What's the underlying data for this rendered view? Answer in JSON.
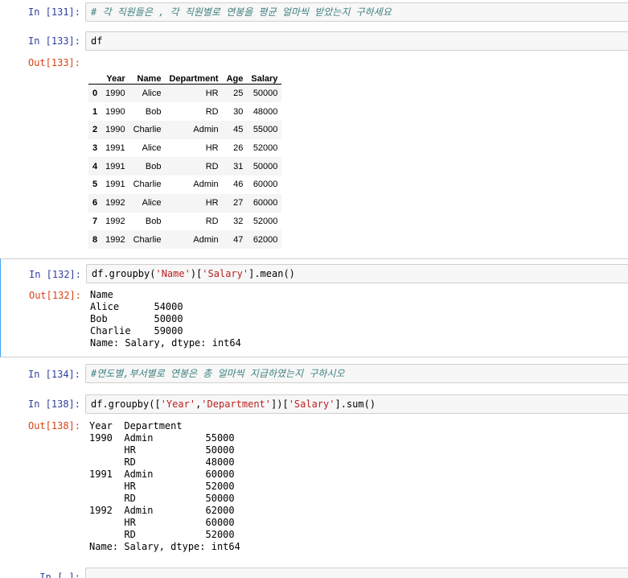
{
  "cells": [
    {
      "prompt": "In [131]:",
      "comment": "# 각 직원들은 , 각 직원별로 연봉을 평균 얼마씩 받았는지 구하세요"
    },
    {
      "prompt": "In [133]:",
      "code": "df",
      "out_prompt": "Out[133]:"
    },
    {
      "prompt": "In [132]:",
      "out_prompt": "Out[132]:",
      "code_parts": [
        "df.groupby(",
        "'Name'",
        ")[",
        "'Salary'",
        "].mean()"
      ],
      "output": "Name\nAlice      54000\nBob        50000\nCharlie    59000\nName: Salary, dtype: int64"
    },
    {
      "prompt": "In [134]:",
      "comment": "#연도별,부서별로 연봉은 총 얼마씩 지급하였는지 구하시오"
    },
    {
      "prompt": "In [138]:",
      "out_prompt": "Out[138]:",
      "code_parts": [
        "df.groupby([",
        "'Year'",
        ",",
        "'Department'",
        "])[",
        "'Salary'",
        "].sum()"
      ],
      "output": "Year  Department\n1990  Admin         55000\n      HR            50000\n      RD            48000\n1991  Admin         60000\n      HR            52000\n      RD            50000\n1992  Admin         62000\n      HR            60000\n      RD            52000\nName: Salary, dtype: int64"
    },
    {
      "prompt": "In [ ]:"
    }
  ],
  "dataframe": {
    "columns": [
      "",
      "Year",
      "Name",
      "Department",
      "Age",
      "Salary"
    ],
    "rows": [
      [
        "0",
        "1990",
        "Alice",
        "HR",
        "25",
        "50000"
      ],
      [
        "1",
        "1990",
        "Bob",
        "RD",
        "30",
        "48000"
      ],
      [
        "2",
        "1990",
        "Charlie",
        "Admin",
        "45",
        "55000"
      ],
      [
        "3",
        "1991",
        "Alice",
        "HR",
        "26",
        "52000"
      ],
      [
        "4",
        "1991",
        "Bob",
        "RD",
        "31",
        "50000"
      ],
      [
        "5",
        "1991",
        "Charlie",
        "Admin",
        "46",
        "60000"
      ],
      [
        "6",
        "1992",
        "Alice",
        "HR",
        "27",
        "60000"
      ],
      [
        "7",
        "1992",
        "Bob",
        "RD",
        "32",
        "52000"
      ],
      [
        "8",
        "1992",
        "Charlie",
        "Admin",
        "47",
        "62000"
      ]
    ]
  }
}
